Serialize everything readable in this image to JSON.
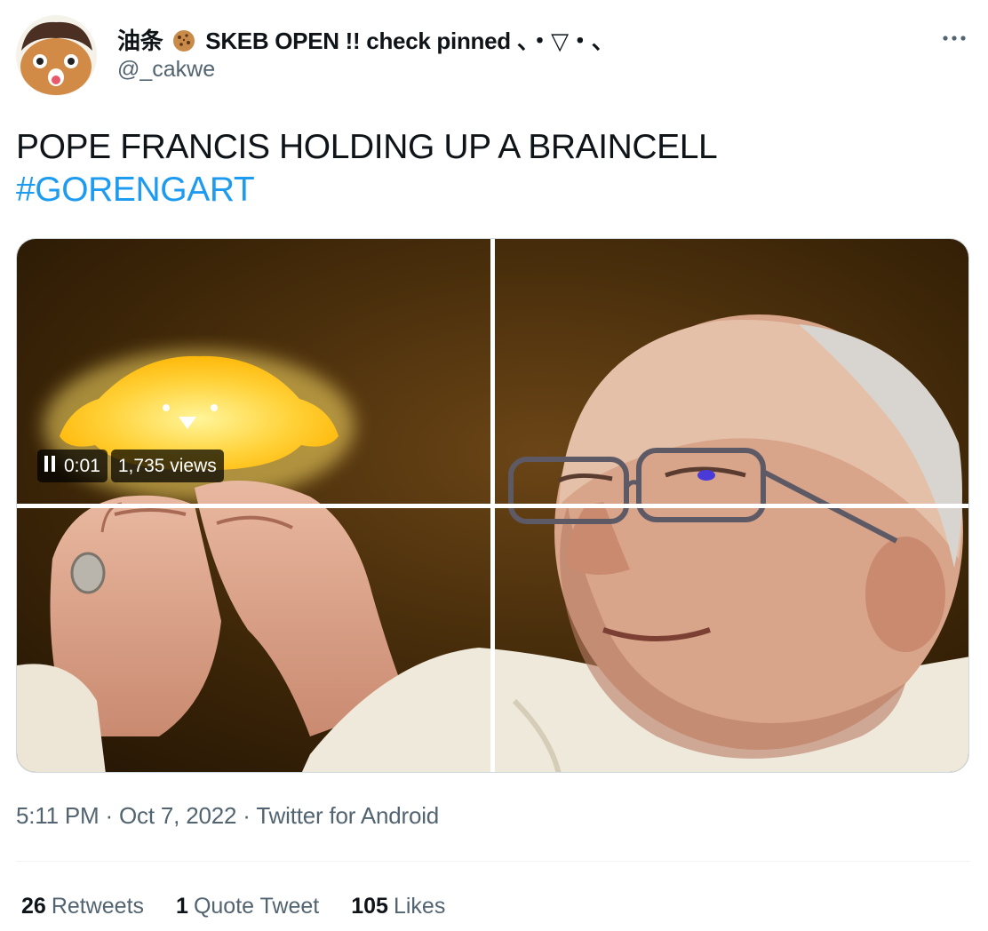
{
  "author": {
    "display_name_prefix": "油条",
    "display_name_suffix": "SKEB OPEN !! check pinned 、・▽・、",
    "handle": "@_cakwe",
    "avatar_icon": "cartoon-face-avatar",
    "cookie_icon": "cookie-emoji"
  },
  "tweet": {
    "text": "POPE FRANCIS HOLDING UP A BRAINCELL",
    "hashtag": "#GORENGART"
  },
  "media": {
    "type": "video",
    "elapsed": "0:01",
    "views": "1,735 views"
  },
  "meta": {
    "time": "5:11 PM",
    "separator": "·",
    "date": "Oct 7, 2022",
    "source": "Twitter for Android"
  },
  "stats": {
    "retweets_count": "26",
    "retweets_label": "Retweets",
    "quotes_count": "1",
    "quotes_label": "Quote Tweet",
    "likes_count": "105",
    "likes_label": "Likes"
  },
  "colors": {
    "link": "#1d9bf0",
    "secondary_text": "#536471",
    "primary_text": "#0f1419"
  }
}
